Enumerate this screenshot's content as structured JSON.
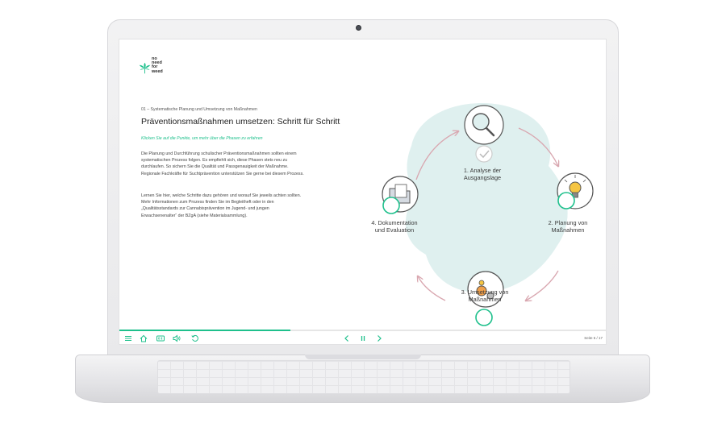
{
  "logo": {
    "lines": [
      "no",
      "need",
      "for",
      "weed"
    ]
  },
  "content": {
    "breadcrumb": "01 – Systematische Planung und Umsetzung von Maßnahmen",
    "title": "Präventionsmaßnahmen umsetzen: Schritt für Schritt",
    "hint": "Klicken Sie auf die Punkte, um mehr über die Phasen zu erfahren",
    "paragraph1": [
      "Die Planung und Durchführung schulischer Präventionsmaßnahmen sollten einem",
      "systematischen Prozess folgen. Es empfiehlt sich, diese Phasen stets neu zu",
      "durchlaufen. So sichern Sie die Qualität und Passgenauigkeit der Maßnahme.",
      "Regionale Fachkräfte für Suchtprävention unterstützen Sie gerne bei diesem Prozess."
    ],
    "paragraph2": [
      "Lernen Sie hier, welche Schritte dazu gehören und worauf Sie jeweils achten sollten.",
      "Mehr Informationen zum Prozess finden Sie im Begleitheft oder in den",
      "„Qualitätsstandards zur Cannabisprävention im Jugend- und jungen",
      "Erwachsenenalter“ der BZgA (siehe Materialsammlung)."
    ]
  },
  "steps": [
    {
      "label_lines": [
        "1. Analyse der",
        "Ausgangslage"
      ],
      "icon": "magnifier-icon",
      "completed": true
    },
    {
      "label_lines": [
        "2. Planung von",
        "Maßnahmen"
      ],
      "icon": "lightbulb-icon",
      "completed": false
    },
    {
      "label_lines": [
        "3. Umsetzung von",
        "Maßnahmen"
      ],
      "icon": "gears-icon",
      "completed": false
    },
    {
      "label_lines": [
        "4. Dokumentation",
        "und Evaluation"
      ],
      "icon": "folder-icon",
      "completed": false
    }
  ],
  "colors": {
    "accent": "#1ec08c",
    "blob": "#dff0ef",
    "arrow": "#d9a7b0"
  },
  "progress": {
    "fraction": 0.35
  },
  "toolbar": {
    "icons": [
      "menu-icon",
      "home-icon",
      "cc-icon",
      "volume-icon",
      "replay-icon",
      "prev-icon",
      "pause-icon",
      "next-icon"
    ],
    "page_counter": "Seite 6 / 17"
  }
}
